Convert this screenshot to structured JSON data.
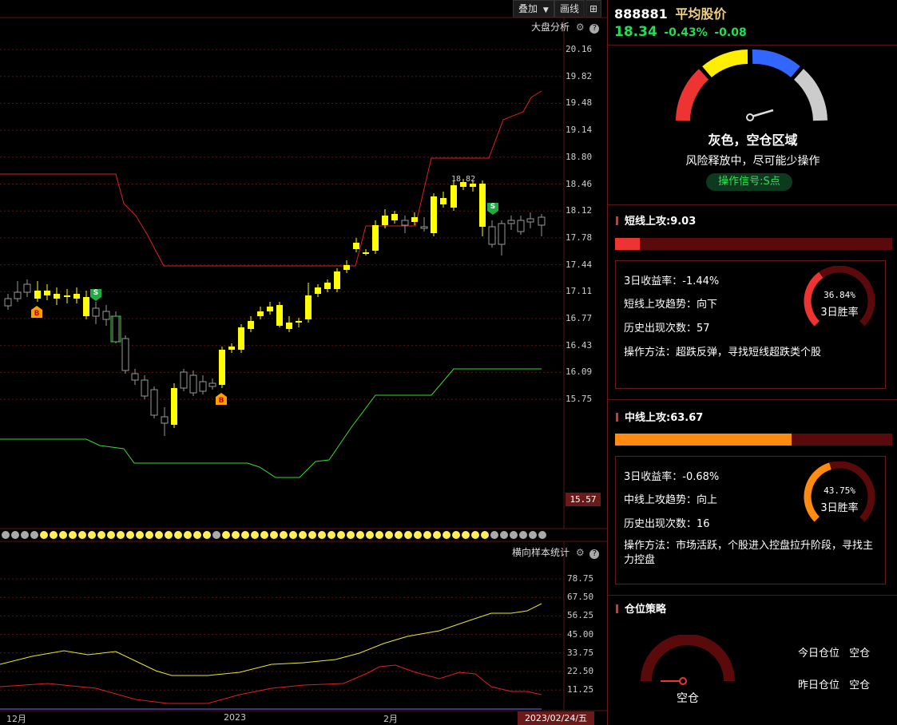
{
  "toolbar": {
    "overlay_label": "叠加",
    "draw_label": "画线"
  },
  "main_chart": {
    "indicator_label": "大盘分析",
    "price_axis": [
      "20.16",
      "19.82",
      "19.48",
      "19.14",
      "18.80",
      "18.46",
      "18.12",
      "17.78",
      "17.44",
      "17.11",
      "16.77",
      "16.43",
      "16.09",
      "15.75"
    ],
    "current_low_tag": "15.57",
    "max_price_label": "18.82",
    "buy_marker": "B",
    "sell_marker": "S"
  },
  "sub_chart": {
    "title": "横向样本统计",
    "axis": [
      "78.75",
      "67.50",
      "56.25",
      "45.00",
      "33.75",
      "22.50",
      "11.25"
    ]
  },
  "dates": {
    "d1": "12月",
    "d2": "2023",
    "d3": "2月",
    "current": "2023/02/24/五"
  },
  "header": {
    "code": "888881",
    "name": "平均股价",
    "price": "18.34",
    "change_pct": "-0.43%",
    "change": "-0.08"
  },
  "gauge": {
    "zone_title": "灰色，空仓区域",
    "zone_desc": "风险释放中，尽可能少操作",
    "signal": "操作信号:S点"
  },
  "short_term": {
    "title": "短线上攻:9.03",
    "progress": 0.09,
    "ret3": "3日收益率：-1.44%",
    "trend": "短线上攻趋势：向下",
    "count": "历史出现次数：57",
    "method": "操作方法：超跌反弹，寻找短线超跌类个股",
    "winrate_value": "36.84%",
    "winrate_pct": 36.84,
    "winrate_label": "3日胜率"
  },
  "mid_term": {
    "title": "中线上攻:63.67",
    "progress": 0.6367,
    "ret3": "3日收益率：-0.68%",
    "trend": "中线上攻趋势：向上",
    "count": "历史出现次数：16",
    "method": "操作方法：市场活跃，个股进入控盘拉升阶段，寻找主力控盘",
    "winrate_value": "43.75%",
    "winrate_pct": 43.75,
    "winrate_label": "3日胜率"
  },
  "position": {
    "title": "仓位策略",
    "gauge_label": "空仓",
    "today_label": "今日仓位",
    "today_value": "空仓",
    "yesterday_label": "昨日仓位",
    "yesterday_value": "空仓"
  },
  "colors": {
    "up": "#ffff00",
    "down": "#888888",
    "upper_band": "#e02020",
    "lower_band": "#33dd33",
    "accent": "#e0302f",
    "mid_bar": "#ff8c10",
    "price_green": "#22dd55"
  }
}
